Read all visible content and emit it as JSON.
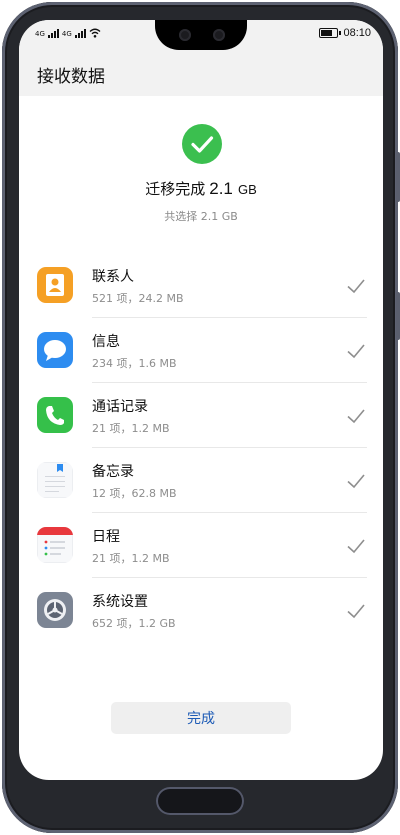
{
  "status_bar": {
    "sim1": "4G",
    "sim2": "4G",
    "time": "08:10",
    "battery_level": 0.85
  },
  "header": {
    "title": "接收数据"
  },
  "summary": {
    "prefix": "迁移完成",
    "size": "2.1",
    "unit": "GB",
    "selected": "共选择 2.1 GB"
  },
  "items": [
    {
      "name": "联系人",
      "meta": "521 项，24.2 MB",
      "icon": "contacts-icon"
    },
    {
      "name": "信息",
      "meta": "234 项，1.6 MB",
      "icon": "messages-icon"
    },
    {
      "name": "通话记录",
      "meta": "21 项，1.2 MB",
      "icon": "phone-icon"
    },
    {
      "name": "备忘录",
      "meta": "12 项，62.8 MB",
      "icon": "notes-icon"
    },
    {
      "name": "日程",
      "meta": "21 项，1.2 MB",
      "icon": "calendar-icon"
    },
    {
      "name": "系统设置",
      "meta": "652 项，1.2 GB",
      "icon": "settings-icon"
    }
  ],
  "done_button": {
    "label": "完成"
  },
  "colors": {
    "success": "#3bbf4f",
    "accent": "#1d5bb6"
  }
}
